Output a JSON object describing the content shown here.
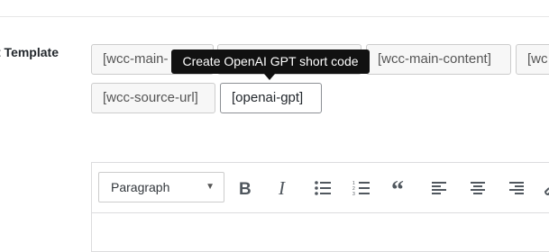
{
  "field": {
    "label": "t Template"
  },
  "shortcodes": [
    {
      "label": "[wcc-main-"
    },
    {
      "label": ""
    },
    {
      "label": "[wcc-main-content]"
    },
    {
      "label": "[wc"
    },
    {
      "label": "[wcc-source-url]"
    },
    {
      "label": "[openai-gpt]"
    }
  ],
  "tooltip": {
    "text": "Create OpenAI GPT short code"
  },
  "editor": {
    "format_value": "Paragraph",
    "icons": [
      "bold-icon",
      "italic-icon",
      "bulleted-list-icon",
      "numbered-list-icon",
      "blockquote-icon",
      "align-left-icon",
      "align-center-icon",
      "align-right-icon",
      "link-icon"
    ]
  }
}
